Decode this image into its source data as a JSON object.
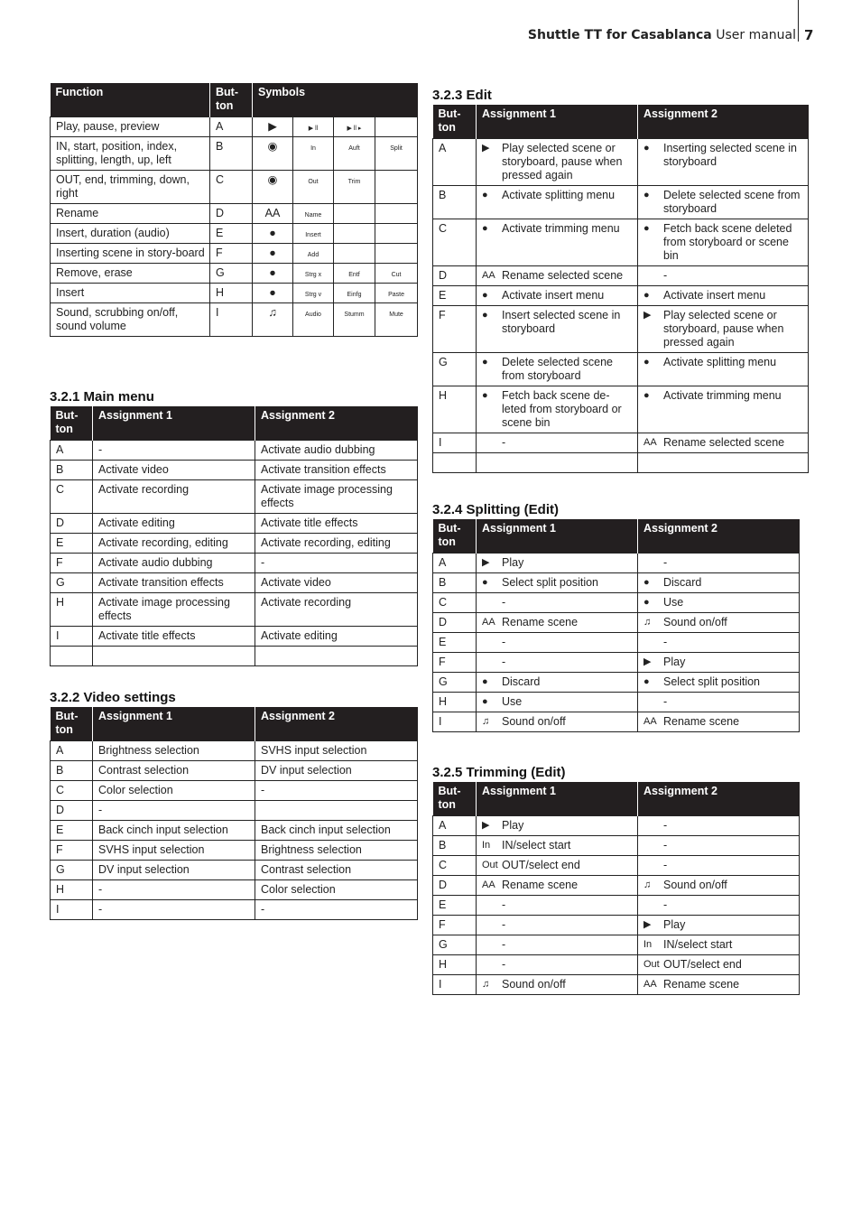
{
  "header": {
    "product": "Shuttle TT for Casablanca",
    "doc": "User manual",
    "page": "7"
  },
  "icons": {
    "play": "▶",
    "play_pause": "▶ ll",
    "play_pause_frame": "▶ ll ▸",
    "in_circle": "◉",
    "out_circle": "◉",
    "rename": "AA",
    "insert_i": "●",
    "add_plus": "●",
    "remove_x": "●",
    "paste": "●",
    "sound": "♫",
    "in_text": "In",
    "out_text": "Out"
  },
  "functions_table": {
    "headers": [
      "Function",
      "But-\nton",
      "Symbols"
    ],
    "rows": [
      {
        "function": "Play, pause, preview",
        "button": "A",
        "symbols": [
          "▶",
          "▶ ll",
          "▶ ll ▸",
          ""
        ]
      },
      {
        "function": "IN, start, position, index, splitting, length, up, left",
        "button": "B",
        "symbols": [
          "◉",
          "In",
          "Auft",
          "Split"
        ]
      },
      {
        "function": "OUT, end, trimming, down, right",
        "button": "C",
        "symbols": [
          "◉",
          "Out",
          "Trim",
          ""
        ]
      },
      {
        "function": "Rename",
        "button": "D",
        "symbols": [
          "AA",
          "Name",
          "",
          ""
        ]
      },
      {
        "function": "Insert, duration (audio)",
        "button": "E",
        "symbols": [
          "●",
          "Insert",
          "",
          ""
        ]
      },
      {
        "function": "Inserting scene in story-board",
        "button": "F",
        "symbols": [
          "●",
          "Add",
          "",
          ""
        ]
      },
      {
        "function": "Remove, erase",
        "button": "G",
        "symbols": [
          "●",
          "Strg x",
          "Entf",
          "Cut"
        ]
      },
      {
        "function": "Insert",
        "button": "H",
        "symbols": [
          "●",
          "Strg v",
          "Einfg",
          "Paste"
        ]
      },
      {
        "function": "Sound, scrubbing on/off, sound volume",
        "button": "I",
        "symbols": [
          "♫",
          "Audio",
          "Stumm",
          "Mute"
        ]
      }
    ]
  },
  "main_menu": {
    "title": "3.2.1 Main menu",
    "headers": [
      "But-ton",
      "Assignment 1",
      "Assignment 2"
    ],
    "rows": [
      {
        "b": "A",
        "a1": "-",
        "a2": "Activate audio dubbing"
      },
      {
        "b": "B",
        "a1": "Activate video",
        "a2": "Activate transition effects"
      },
      {
        "b": "C",
        "a1": "Activate recording",
        "a2": "Activate image processing effects"
      },
      {
        "b": "D",
        "a1": "Activate editing",
        "a2": "Activate title effects"
      },
      {
        "b": "E",
        "a1": "Activate recording, editing",
        "a2": "Activate recording, editing"
      },
      {
        "b": "F",
        "a1": "Activate audio dubbing",
        "a2": "-"
      },
      {
        "b": "G",
        "a1": "Activate transition effects",
        "a2": "Activate video"
      },
      {
        "b": "H",
        "a1": "Activate image processing effects",
        "a2": "Activate recording"
      },
      {
        "b": "I",
        "a1": "Activate title effects",
        "a2": "Activate editing"
      },
      {
        "b": "",
        "a1": "",
        "a2": ""
      }
    ]
  },
  "video_settings": {
    "title": "3.2.2 Video settings",
    "headers": [
      "But-ton",
      "Assignment 1",
      "Assignment 2"
    ],
    "rows": [
      {
        "b": "A",
        "a1": "Brightness selection",
        "a2": "SVHS input selection"
      },
      {
        "b": "B",
        "a1": "Contrast selection",
        "a2": "DV input selection"
      },
      {
        "b": "C",
        "a1": "Color selection",
        "a2": "-"
      },
      {
        "b": "D",
        "a1": "-",
        "a2": ""
      },
      {
        "b": "E",
        "a1": "Back cinch input selection",
        "a2": "Back cinch input selection"
      },
      {
        "b": "F",
        "a1": "SVHS input selection",
        "a2": "Brightness selection"
      },
      {
        "b": "G",
        "a1": "DV input selection",
        "a2": "Contrast selection"
      },
      {
        "b": "H",
        "a1": "-",
        "a2": "Color selection"
      },
      {
        "b": "I",
        "a1": "-",
        "a2": "-"
      }
    ]
  },
  "edit": {
    "title": "3.2.3 Edit",
    "headers": [
      "But-ton",
      "Assignment 1",
      "Assignment 2"
    ],
    "rows": [
      {
        "b": "A",
        "i1": "▶",
        "a1": "Play selected scene or storyboard, pause when pressed again",
        "i2": "●",
        "a2": "Inserting selected scene in storyboard"
      },
      {
        "b": "B",
        "i1": "●",
        "a1": "Activate splitting menu",
        "i2": "●",
        "a2": "Delete selected scene from storyboard"
      },
      {
        "b": "C",
        "i1": "●",
        "a1": "Activate trimming menu",
        "i2": "●",
        "a2": "Fetch back scene deleted from storyboard or scene bin"
      },
      {
        "b": "D",
        "i1": "AA",
        "a1": "Rename selected scene",
        "i2": "",
        "a2": "-"
      },
      {
        "b": "E",
        "i1": "●",
        "a1": "Activate insert menu",
        "i2": "●",
        "a2": "Activate insert menu"
      },
      {
        "b": "F",
        "i1": "●",
        "a1": "Insert selected scene in storyboard",
        "i2": "▶",
        "a2": "Play selected scene or storyboard, pause when pressed again"
      },
      {
        "b": "G",
        "i1": "●",
        "a1": "Delete selected scene from storyboard",
        "i2": "●",
        "a2": "Activate splitting menu"
      },
      {
        "b": "H",
        "i1": "●",
        "a1": "Fetch back scene de-leted from storyboard or scene bin",
        "i2": "●",
        "a2": "Activate trimming menu"
      },
      {
        "b": "I",
        "i1": "",
        "a1": "-",
        "i2": "AA",
        "a2": "Rename selected scene"
      },
      {
        "b": "",
        "i1": "",
        "a1": "",
        "i2": "",
        "a2": ""
      }
    ]
  },
  "splitting": {
    "title": "3.2.4 Splitting (Edit)",
    "headers": [
      "But-ton",
      "Assignment 1",
      "Assignment 2"
    ],
    "rows": [
      {
        "b": "A",
        "i1": "▶",
        "a1": "Play",
        "i2": "",
        "a2": "-"
      },
      {
        "b": "B",
        "i1": "●",
        "a1": "Select split position",
        "i2": "●",
        "a2": "Discard"
      },
      {
        "b": "C",
        "i1": "",
        "a1": "-",
        "i2": "●",
        "a2": "Use"
      },
      {
        "b": "D",
        "i1": "AA",
        "a1": "Rename scene",
        "i2": "♫",
        "a2": "Sound on/off"
      },
      {
        "b": "E",
        "i1": "",
        "a1": "-",
        "i2": "",
        "a2": "-"
      },
      {
        "b": "F",
        "i1": "",
        "a1": "-",
        "i2": "▶",
        "a2": "Play"
      },
      {
        "b": "G",
        "i1": "●",
        "a1": "Discard",
        "i2": "●",
        "a2": "Select split position"
      },
      {
        "b": "H",
        "i1": "●",
        "a1": "Use",
        "i2": "",
        "a2": "-"
      },
      {
        "b": "I",
        "i1": "♫",
        "a1": "Sound on/off",
        "i2": "AA",
        "a2": "Rename scene"
      }
    ]
  },
  "trimming": {
    "title": "3.2.5 Trimming (Edit)",
    "headers": [
      "But-ton",
      "Assignment 1",
      "Assignment 2"
    ],
    "rows": [
      {
        "b": "A",
        "i1": "▶",
        "a1": "Play",
        "i2": "",
        "a2": "-"
      },
      {
        "b": "B",
        "i1": "In",
        "a1": "IN/select start",
        "i2": "",
        "a2": "-"
      },
      {
        "b": "C",
        "i1": "Out",
        "a1": "OUT/select end",
        "i2": "",
        "a2": "-"
      },
      {
        "b": "D",
        "i1": "AA",
        "a1": "Rename scene",
        "i2": "♫",
        "a2": "Sound on/off"
      },
      {
        "b": "E",
        "i1": "",
        "a1": "-",
        "i2": "",
        "a2": "-"
      },
      {
        "b": "F",
        "i1": "",
        "a1": "-",
        "i2": "▶",
        "a2": "Play"
      },
      {
        "b": "G",
        "i1": "",
        "a1": "-",
        "i2": "In",
        "a2": "IN/select start"
      },
      {
        "b": "H",
        "i1": "",
        "a1": "-",
        "i2": "Out",
        "a2": "OUT/select end"
      },
      {
        "b": "I",
        "i1": "♫",
        "a1": "Sound on/off",
        "i2": "AA",
        "a2": "Rename scene"
      }
    ]
  }
}
